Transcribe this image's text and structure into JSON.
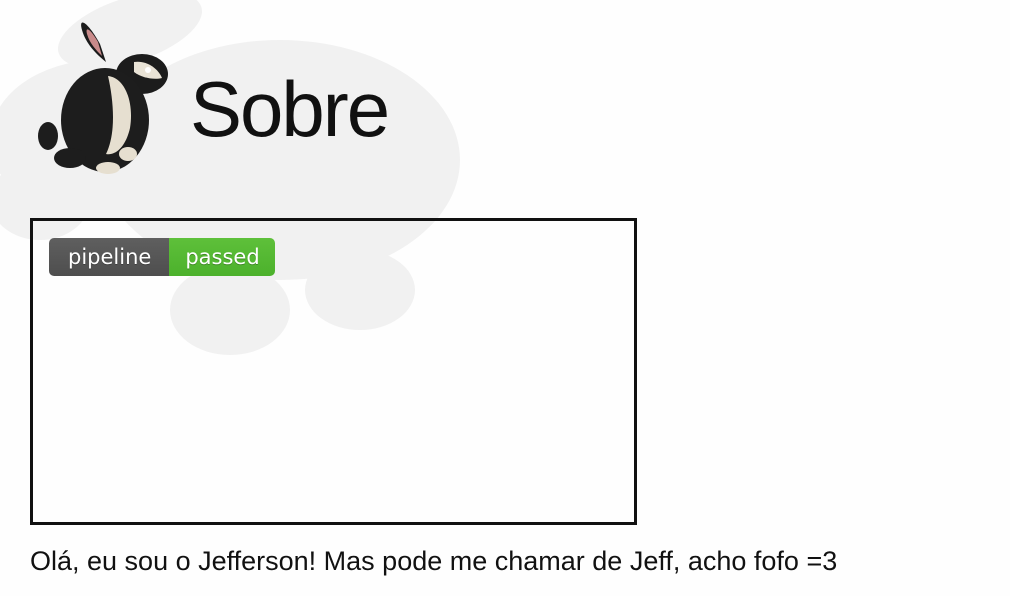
{
  "page": {
    "title": "Sobre",
    "about_text": "Olá, eu sou o Jefferson! Mas pode me chamar de Jeff, acho fofo =3"
  },
  "header": {
    "logo_icon": "bunny-icon",
    "watermark_icon": "bunny-watermark-icon"
  },
  "badge": {
    "label": "pipeline",
    "status": "passed",
    "label_color": "#555555",
    "status_color": "#4cb12c"
  }
}
